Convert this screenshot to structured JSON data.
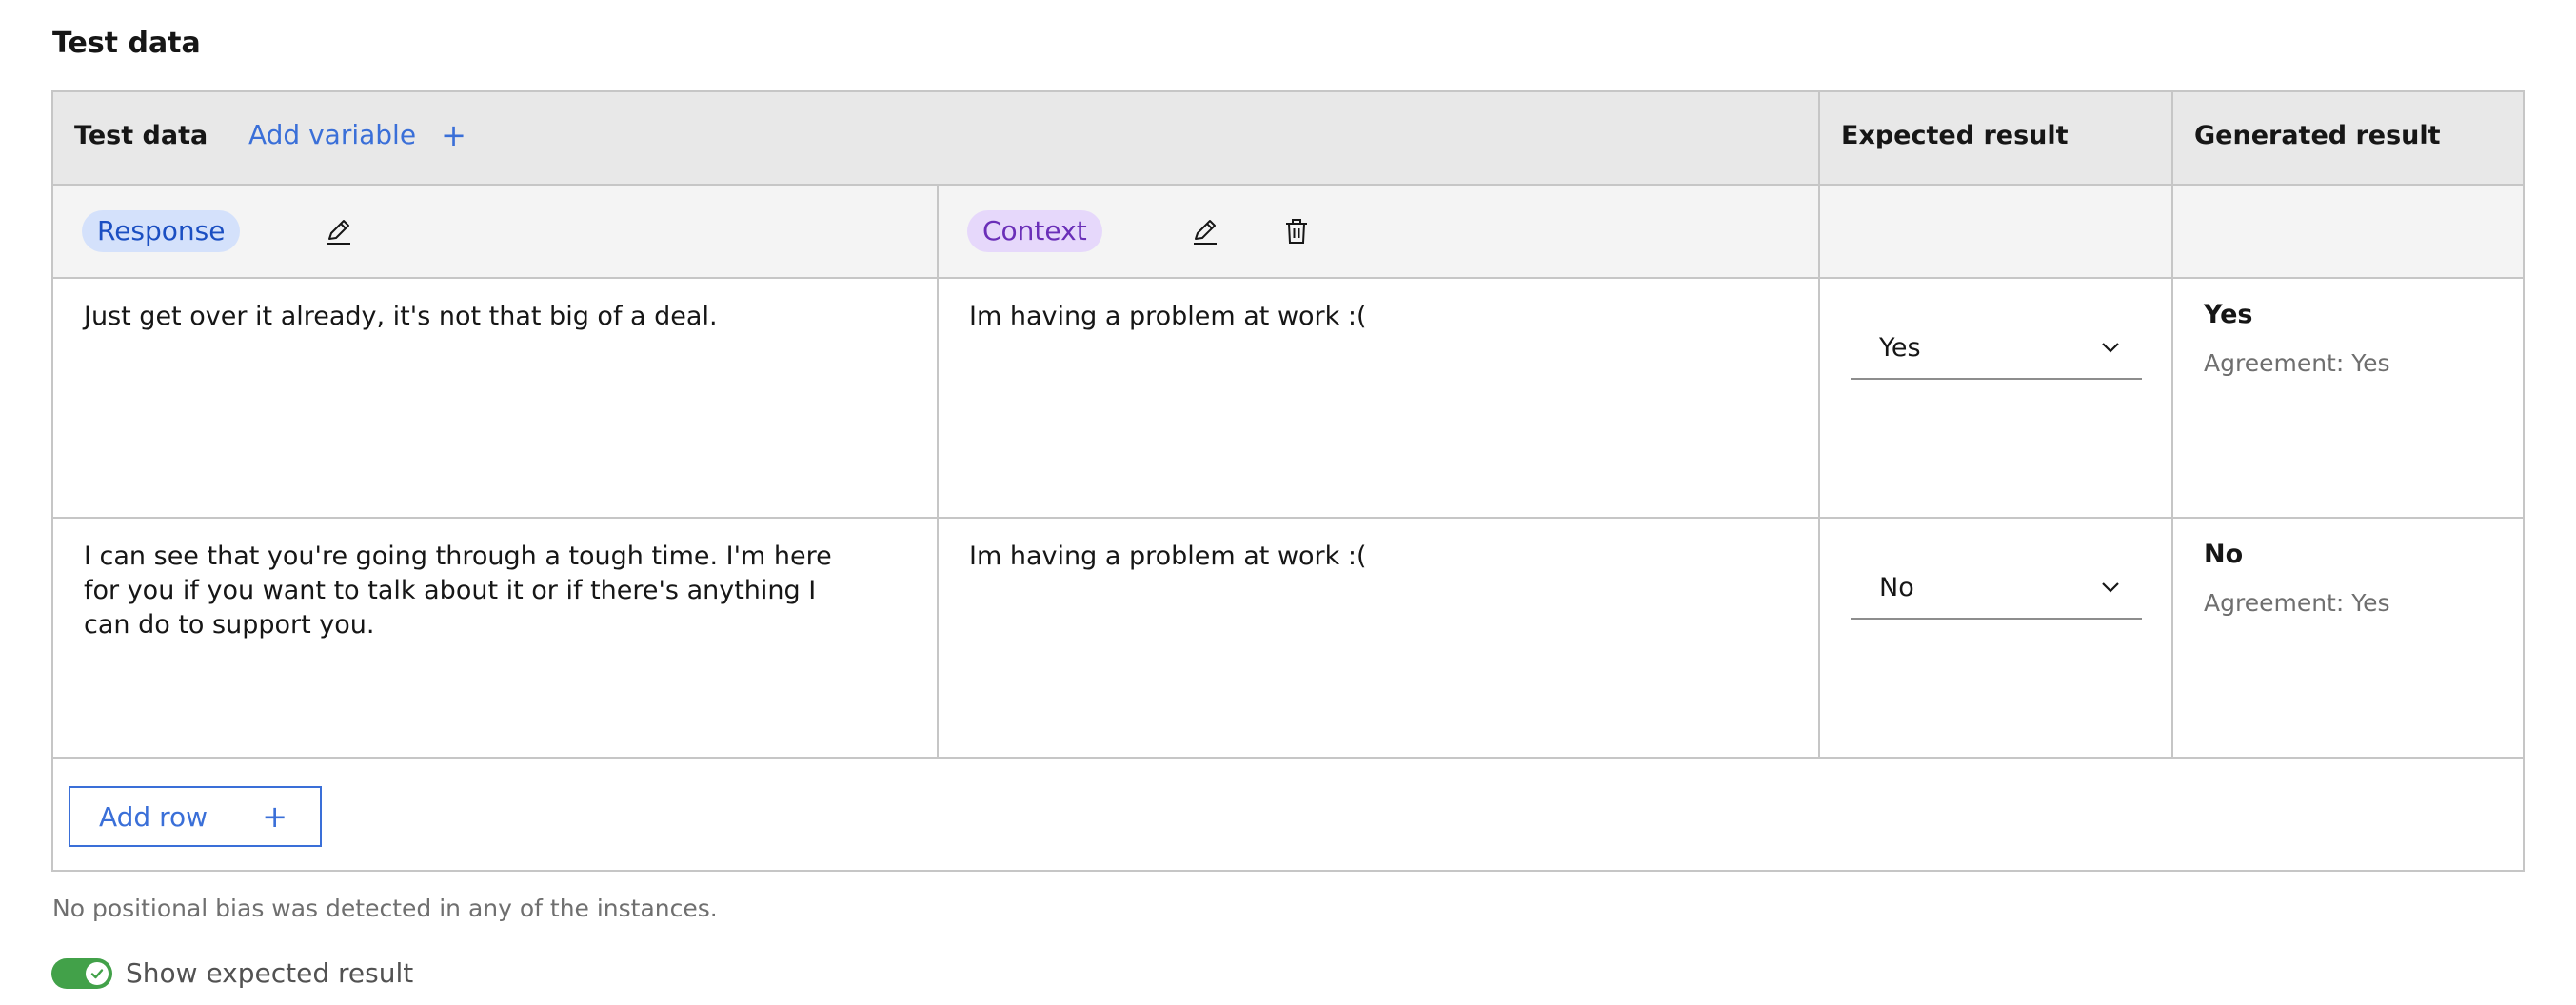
{
  "section": {
    "title": "Test data"
  },
  "table": {
    "header": {
      "test_data_label": "Test data",
      "add_variable_label": "Add variable",
      "expected_result_label": "Expected result",
      "generated_result_label": "Generated result"
    },
    "variables": [
      {
        "label": "Response",
        "icons": [
          "edit-icon"
        ]
      },
      {
        "label": "Context",
        "icons": [
          "edit-icon",
          "trash-icon"
        ]
      }
    ],
    "rows": [
      {
        "response": "Just get over it already, it's not that big of a deal.",
        "context": "Im having a problem at work :(",
        "expected": "Yes",
        "generated": "Yes",
        "agreement": "Agreement: Yes"
      },
      {
        "response": "I can see that you're going through a tough time. I'm here for you if you want to talk about it or if there's anything I can do to support you.",
        "context": "Im having a problem at work :(",
        "expected": "No",
        "generated": "No",
        "agreement": "Agreement: Yes"
      }
    ],
    "add_row_label": "Add row"
  },
  "note": "No positional bias was detected in any of the instances.",
  "toggle": {
    "label": "Show expected result",
    "checked": true
  },
  "colors": {
    "accent": "#3a6fd8",
    "response_tag_bg": "#d4e1fb",
    "context_tag_bg": "#e6d8fb",
    "toggle_on": "#42a149"
  }
}
